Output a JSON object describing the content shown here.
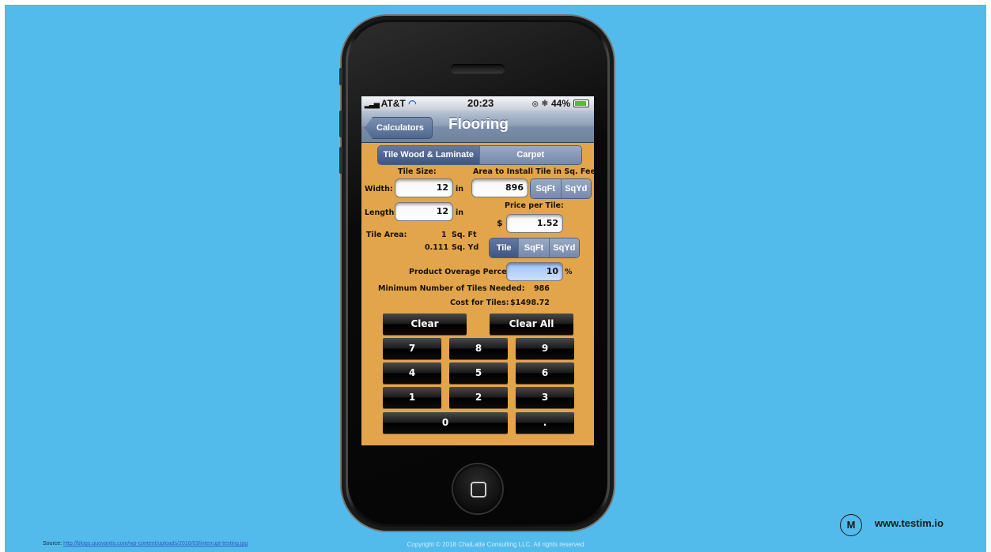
{
  "status_bar": {
    "carrier": "AT&T",
    "time": "20:23",
    "battery": "44%"
  },
  "nav": {
    "back_label": "Calculators",
    "title": "Flooring"
  },
  "tabs": [
    {
      "label": "Tile Wood & Laminate",
      "selected": true
    },
    {
      "label": "Carpet",
      "selected": false
    }
  ],
  "form": {
    "tile_size_label": "Tile Size:",
    "area_label": "Area to Install Tile in Sq. Feet:",
    "width_label": "Width:",
    "width_value": "12",
    "width_unit": "in",
    "length_label": "Length:",
    "length_value": "12",
    "length_unit": "in",
    "area_value": "896",
    "area_units": [
      {
        "label": "SqFt",
        "selected": false
      },
      {
        "label": "SqYd",
        "selected": false
      }
    ],
    "price_label": "Price per Tile:",
    "price_currency": "$",
    "price_value": "1.52",
    "price_units": [
      {
        "label": "Tile",
        "selected": true
      },
      {
        "label": "SqFt",
        "selected": false
      },
      {
        "label": "SqYd",
        "selected": false
      }
    ],
    "tile_area_label": "Tile Area:",
    "tile_area_sqft": "1",
    "tile_area_sqft_unit": "Sq. Ft",
    "tile_area_sqyd": "0.111",
    "tile_area_sqyd_unit": "Sq. Yd",
    "overage_label": "Product Overage Percent:",
    "overage_value": "10",
    "overage_unit": "%",
    "min_tiles_label": "Minimum Number of Tiles Needed:",
    "min_tiles_value": "986",
    "cost_label": "Cost for Tiles:",
    "cost_value": "$1498.72"
  },
  "keypad": {
    "clear": "Clear",
    "clear_all": "Clear All",
    "keys": [
      "7",
      "8",
      "9",
      "4",
      "5",
      "6",
      "1",
      "2",
      "3",
      "0",
      "."
    ]
  },
  "footer": {
    "source_label": "Source:",
    "source_url": "http://blogs.quovantis.com/wp-content/uploads/2016/03/interrupt-testing.jpg",
    "copyright": "Copyright © 2018 ChaiLatte Consulting LLC. All rights reserved",
    "logo_letter": "M",
    "site": "www.testim.io"
  },
  "colors": {
    "background": "#52bbec",
    "screen": "#e2a54b",
    "navbar": "#7a8ea9",
    "selected_field": "#9cc0f6"
  }
}
